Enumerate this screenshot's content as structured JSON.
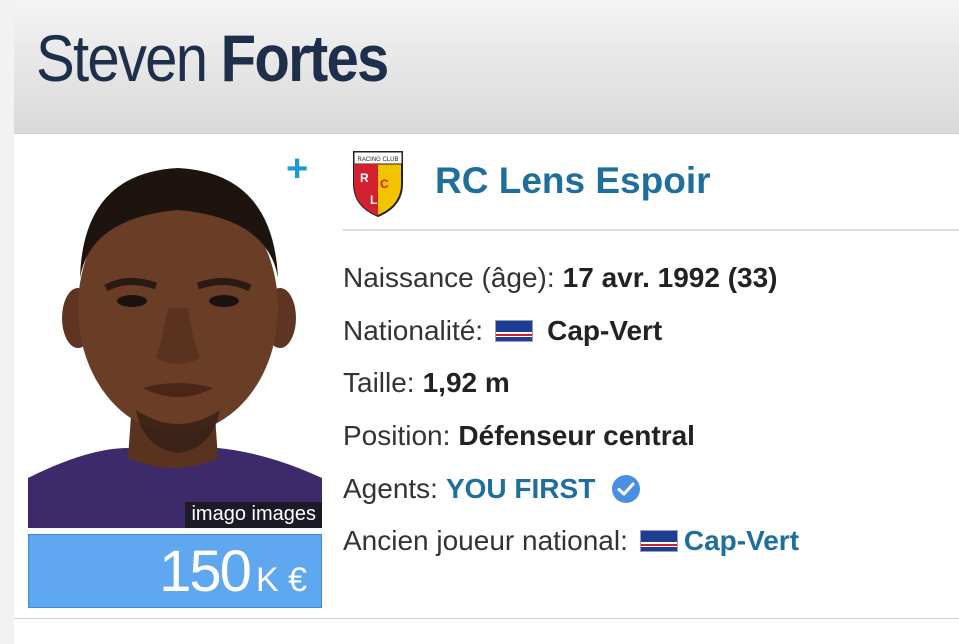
{
  "header": {
    "first_name": "Steven",
    "last_name": "Fortes"
  },
  "photo": {
    "credit": "imago images"
  },
  "market_value": {
    "amount": "150",
    "unit": "K €"
  },
  "club": {
    "name": "RC Lens Espoir",
    "logo_icon": "rc-lens-crest-icon",
    "logo_text": "RCL"
  },
  "info": {
    "birth": {
      "label": "Naissance (âge):",
      "value": "17 avr. 1992 (33)"
    },
    "nationality": {
      "label": "Nationalité:",
      "value": "Cap-Vert",
      "flag_icon": "cape-verde-flag-icon"
    },
    "height": {
      "label": "Taille:",
      "value": "1,92 m"
    },
    "position": {
      "label": "Position:",
      "value": "Défenseur central"
    },
    "agents": {
      "label": "Agents:",
      "value": "YOU FIRST",
      "badge_icon": "verified-check-icon"
    },
    "former_international": {
      "label": "Ancien joueur national:",
      "value": "Cap-Vert",
      "flag_icon": "cape-verde-flag-icon"
    }
  },
  "colors": {
    "name_text": "#1d2f4a",
    "link_blue": "#1f6f9c",
    "accent_blue": "#1b9ad6",
    "market_value_bg": "#5fa8f0",
    "verified_badge": "#4a90e2"
  }
}
